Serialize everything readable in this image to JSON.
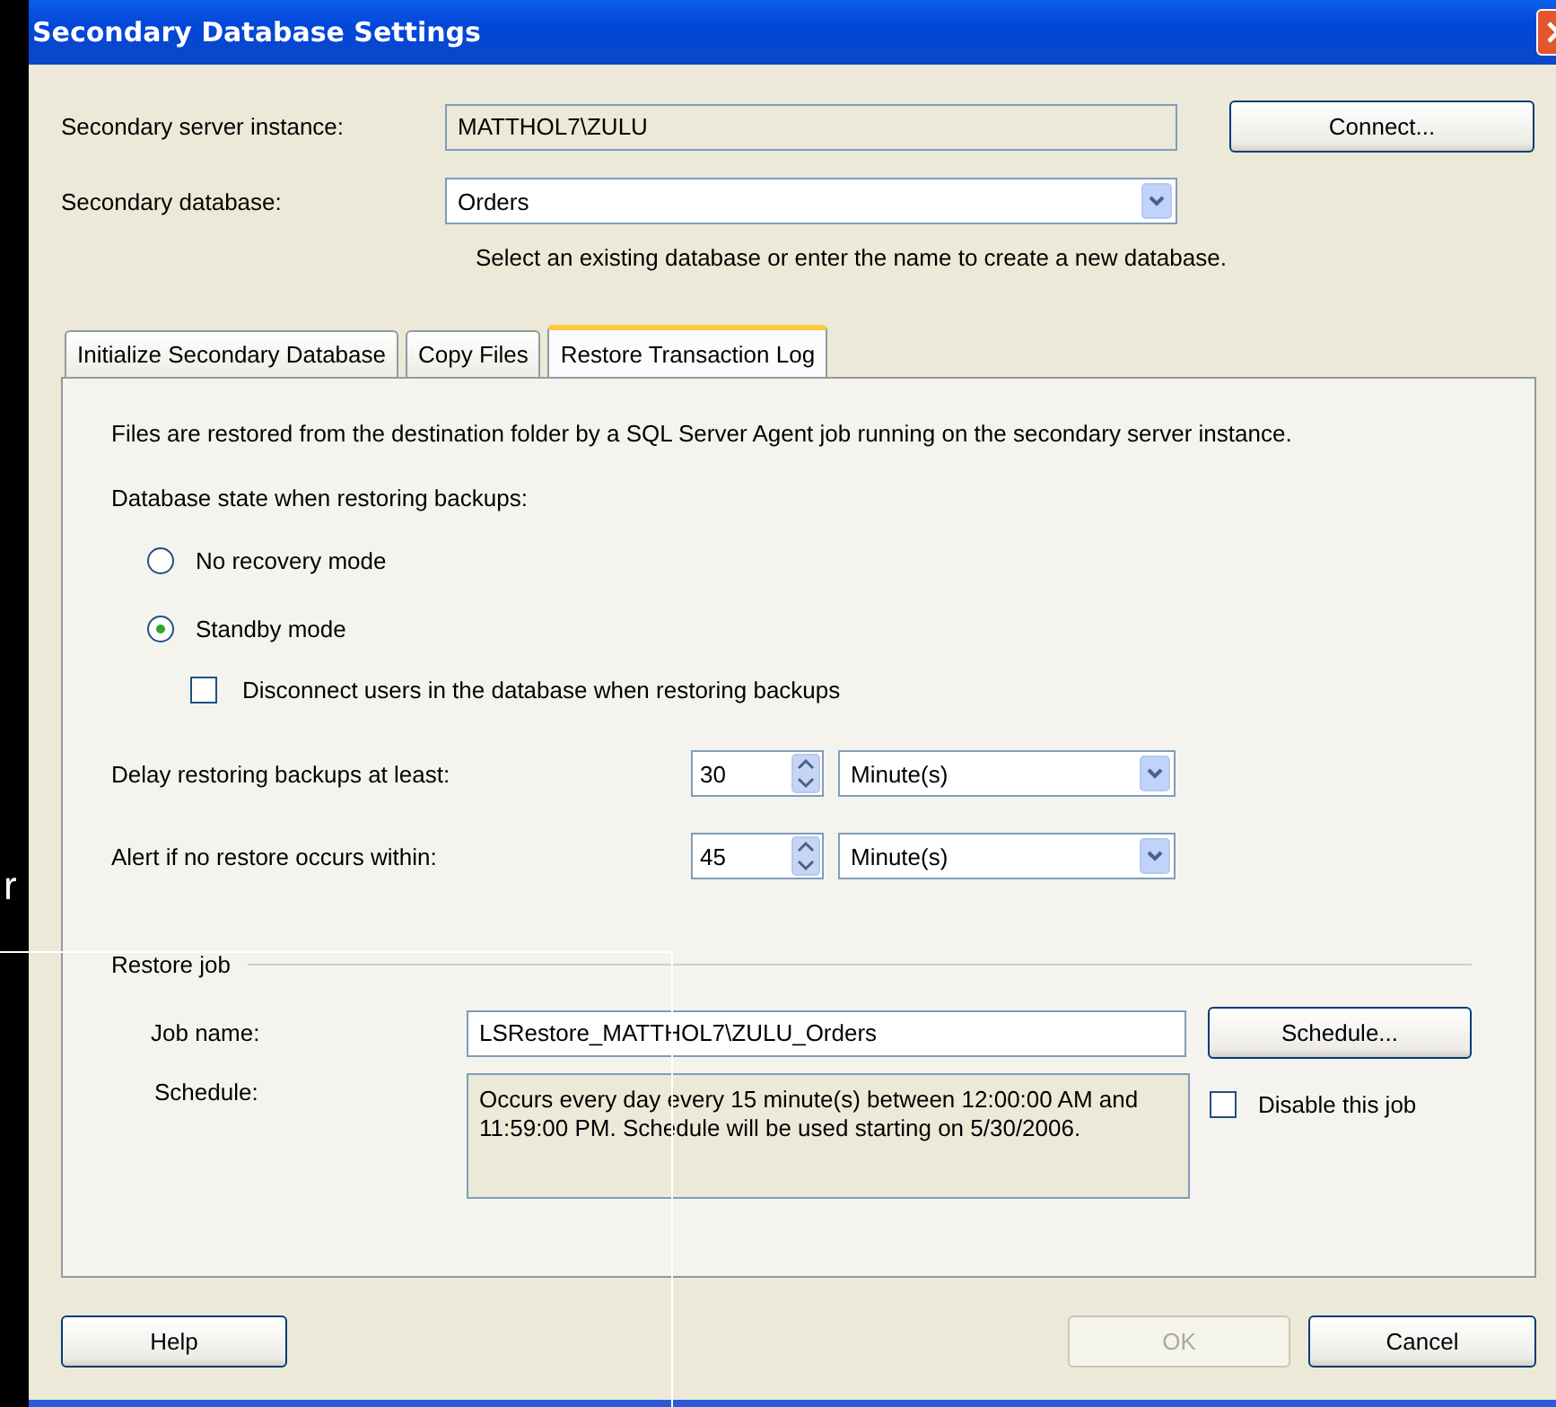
{
  "window": {
    "title": "Secondary Database Settings"
  },
  "server": {
    "label": "Secondary server instance:",
    "value": "MATTHOL7\\ZULU",
    "button": "Connect..."
  },
  "database": {
    "label": "Secondary database:",
    "value": "Orders",
    "hint": "Select an existing database or enter the name to create a new database."
  },
  "tabs": [
    {
      "label": "Initialize Secondary Database",
      "selected": false
    },
    {
      "label": "Copy Files",
      "selected": false
    },
    {
      "label": "Restore Transaction Log",
      "selected": true
    }
  ],
  "panel": {
    "intro": "Files are restored from the destination folder by a SQL Server Agent job running on the secondary server instance.",
    "state_label": "Database state when restoring backups:",
    "options": [
      {
        "kind": "radio",
        "label": "No recovery mode",
        "selected": false
      },
      {
        "kind": "radio",
        "label": "Standby mode",
        "selected": true
      },
      {
        "kind": "checkbox",
        "label": "Disconnect users in the database when restoring backups",
        "checked": false
      }
    ],
    "timings": [
      {
        "label": "Delay restoring backups at least:",
        "value": "30",
        "unit": "Minute(s)"
      },
      {
        "label": "Alert if no restore occurs within:",
        "value": "45",
        "unit": "Minute(s)"
      }
    ],
    "restore_job": {
      "title": "Restore job",
      "job_name_label": "Job name:",
      "job_name": "LSRestore_MATTHOL7\\ZULU_Orders",
      "schedule_button": "Schedule...",
      "schedule_label": "Schedule:",
      "schedule": "Occurs every day every 15 minute(s) between 12:00:00 AM and 11:59:00 PM. Schedule will be used starting on 5/30/2006.",
      "disable": {
        "label": "Disable this job",
        "checked": false
      }
    }
  },
  "buttons": [
    {
      "label": "Help",
      "disabled": false
    },
    {
      "label": "OK",
      "disabled": true
    },
    {
      "label": "Cancel",
      "disabled": false
    }
  ],
  "overlay_text": "r"
}
